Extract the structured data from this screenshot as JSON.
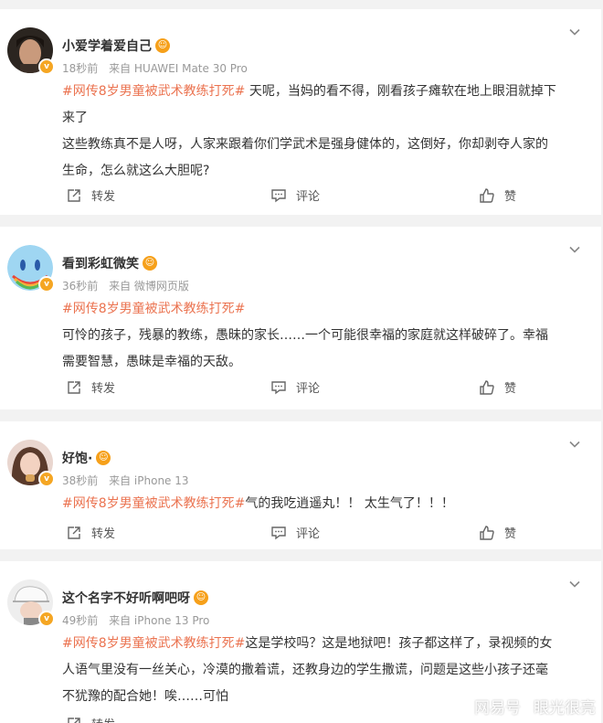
{
  "actions": {
    "share_label": "转发",
    "comment_label": "评论",
    "like_label": "赞"
  },
  "posts": [
    {
      "username": "小爱学着爱自己",
      "time": "18秒前",
      "source": "来自 HUAWEI Mate 30 Pro",
      "topic": "#网传8岁男童被武术教练打死#",
      "line1_rest": " 天呢，当妈的看不得，刚看孩子瘫软在地上眼泪就掉下",
      "line2": "来了",
      "line3": "这些教练真不是人呀，人家来跟着你们学武术是强身健体的，这倒好，你却剥夺人家的",
      "line4": "生命，怎么就这么大胆呢?"
    },
    {
      "username": "看到彩虹微笑",
      "time": "36秒前",
      "source": "来自 微博网页版",
      "topic": "#网传8岁男童被武术教练打死#",
      "line1": "可怜的孩子，残暴的教练，愚昧的家长……一个可能很幸福的家庭就这样破碎了。幸福",
      "line2": "需要智慧，愚昧是幸福的天敌。"
    },
    {
      "username": "好饱·",
      "time": "38秒前",
      "source": "来自 iPhone 13",
      "topic": "#网传8岁男童被武术教练打死#",
      "line1_rest": "气的我吃逍遥丸！！ 太生气了！！！"
    },
    {
      "username": "这个名字不好听啊吧呀",
      "time": "49秒前",
      "source": "来自 iPhone 13 Pro",
      "topic": "#网传8岁男童被武术教练打死#",
      "line1_rest": "这是学校吗？这是地狱吧！孩子都这样了，录视频的女",
      "line2": "人语气里没有一丝关心，冷漠的撒着谎，还教身边的学生撒谎，问题是这些小孩子还毫",
      "line3": "不犹豫的配合她！唉……可怕"
    }
  ],
  "watermark": {
    "left": "网易号",
    "right": "眼光很亮"
  },
  "colors": {
    "topic": "#eb7350",
    "badge": "#f5a623",
    "meta": "#999999"
  }
}
